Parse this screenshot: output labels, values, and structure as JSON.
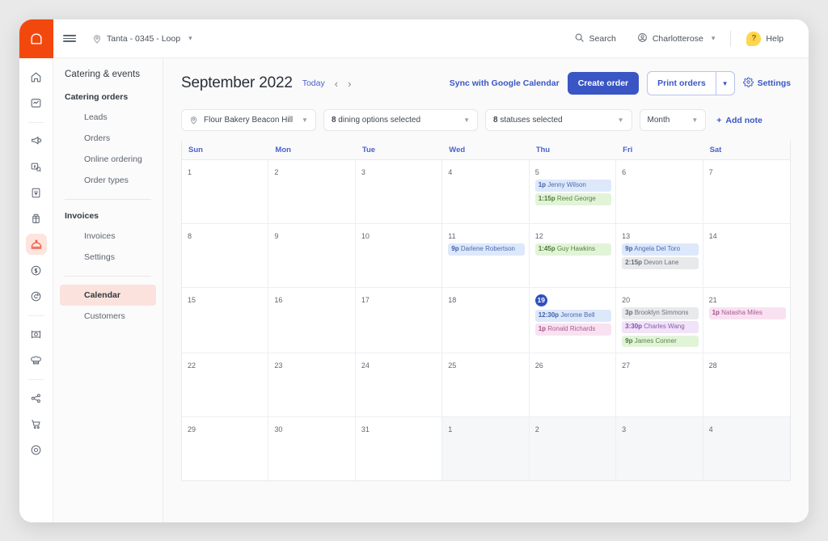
{
  "brand": {
    "logo_icon": "bread-loaf-icon",
    "accent_orange": "#f3480d",
    "accent_blue": "#3a56c4"
  },
  "topbar": {
    "menu_icon": "hamburger-icon",
    "location": {
      "icon": "map-pin-icon",
      "label": "Tanta - 0345 - Loop",
      "caret": "⌄"
    },
    "search": {
      "icon": "search-icon",
      "label": "Search"
    },
    "account": {
      "icon": "user-circle-icon",
      "label": "Charlotterose",
      "caret": "⌄"
    },
    "help": {
      "icon": "question-bubble-icon",
      "badge": "?",
      "label": "Help"
    }
  },
  "rail": {
    "items": [
      {
        "name": "home-icon",
        "active": false
      },
      {
        "name": "analytics-icon",
        "active": false
      },
      {
        "name": "separator",
        "active": false
      },
      {
        "name": "marketing-megaphone-icon",
        "active": false
      },
      {
        "name": "payments-icon",
        "active": false
      },
      {
        "name": "menu-book-icon",
        "active": false
      },
      {
        "name": "gift-card-icon",
        "active": false
      },
      {
        "name": "catering-dome-icon",
        "active": true
      },
      {
        "name": "dollar-circle-icon",
        "active": false
      },
      {
        "name": "loyalty-icon",
        "active": false
      },
      {
        "name": "separator",
        "active": false
      },
      {
        "name": "table-service-icon",
        "active": false
      },
      {
        "name": "chef-hat-icon",
        "active": false
      },
      {
        "name": "separator",
        "active": false
      },
      {
        "name": "share-nodes-icon",
        "active": false
      },
      {
        "name": "shopping-cart-icon",
        "active": false
      },
      {
        "name": "target-circle-icon",
        "active": false
      }
    ]
  },
  "sidebar": {
    "title": "Catering & events",
    "groups": [
      {
        "label": "Catering orders",
        "items": [
          {
            "label": "Leads",
            "active": false
          },
          {
            "label": "Orders",
            "active": false
          },
          {
            "label": "Online ordering",
            "active": false
          },
          {
            "label": "Order types",
            "active": false
          }
        ]
      },
      {
        "label": "Invoices",
        "items": [
          {
            "label": "Invoices",
            "active": false
          },
          {
            "label": "Settings",
            "active": false
          }
        ]
      },
      {
        "label": "",
        "items": [
          {
            "label": "Calendar",
            "active": true
          },
          {
            "label": "Customers",
            "active": false
          }
        ]
      }
    ]
  },
  "toolbar": {
    "month_title": "September 2022",
    "today_label": "Today",
    "prev_icon": "chevron-left-icon",
    "next_icon": "chevron-right-icon",
    "sync_label": "Sync with Google Calendar",
    "create_order_label": "Create order",
    "print_orders_label": "Print orders",
    "print_caret": "▼",
    "settings_label": "Settings",
    "settings_icon": "gear-icon"
  },
  "filters": {
    "location": {
      "icon": "map-pin-icon",
      "label": "Flour Bakery Beacon Hill"
    },
    "dining": {
      "count": "8",
      "label": " dining options selected"
    },
    "statuses": {
      "count": "8",
      "label": " statuses selected"
    },
    "view": {
      "label": "Month"
    },
    "add_note": {
      "icon": "plus-icon",
      "label": "Add note"
    }
  },
  "calendar": {
    "weekdays": [
      "Sun",
      "Mon",
      "Tue",
      "Wed",
      "Thu",
      "Fri",
      "Sat"
    ],
    "today": 19,
    "weeks": [
      [
        {
          "day": "1",
          "out": false,
          "events": []
        },
        {
          "day": "2",
          "out": false,
          "events": []
        },
        {
          "day": "3",
          "out": false,
          "events": []
        },
        {
          "day": "4",
          "out": false,
          "events": []
        },
        {
          "day": "5",
          "out": false,
          "events": [
            {
              "time": "1p",
              "name": "Jenny Wilson",
              "color": "blue"
            },
            {
              "time": "1:15p",
              "name": "Reed George",
              "color": "green"
            }
          ]
        },
        {
          "day": "6",
          "out": false,
          "events": []
        },
        {
          "day": "7",
          "out": false,
          "events": []
        }
      ],
      [
        {
          "day": "8",
          "out": false,
          "events": []
        },
        {
          "day": "9",
          "out": false,
          "events": []
        },
        {
          "day": "10",
          "out": false,
          "events": []
        },
        {
          "day": "11",
          "out": false,
          "events": [
            {
              "time": "9p",
              "name": "Darlene Robertson",
              "color": "blue"
            }
          ]
        },
        {
          "day": "12",
          "out": false,
          "events": [
            {
              "time": "1:45p",
              "name": "Guy Hawkins",
              "color": "green"
            }
          ]
        },
        {
          "day": "13",
          "out": false,
          "events": [
            {
              "time": "9p",
              "name": "Angela Del Toro",
              "color": "blue"
            },
            {
              "time": "2:15p",
              "name": "Devon Lane",
              "color": "grey"
            }
          ]
        },
        {
          "day": "14",
          "out": false,
          "events": []
        }
      ],
      [
        {
          "day": "15",
          "out": false,
          "events": []
        },
        {
          "day": "16",
          "out": false,
          "events": []
        },
        {
          "day": "17",
          "out": false,
          "events": []
        },
        {
          "day": "18",
          "out": false,
          "events": []
        },
        {
          "day": "19",
          "out": false,
          "today": true,
          "events": [
            {
              "time": "12:30p",
              "name": "Jerome Bell",
              "color": "blue"
            },
            {
              "time": "1p",
              "name": "Ronald Richards",
              "color": "pink"
            }
          ]
        },
        {
          "day": "20",
          "out": false,
          "events": [
            {
              "time": "3p",
              "name": "Brooklyn Simmons",
              "color": "grey"
            },
            {
              "time": "3:30p",
              "name": "Charles Wang",
              "color": "purple"
            },
            {
              "time": "9p",
              "name": "James Conner",
              "color": "green"
            }
          ]
        },
        {
          "day": "21",
          "out": false,
          "events": [
            {
              "time": "1p",
              "name": "Natasha Miles",
              "color": "pink"
            }
          ]
        }
      ],
      [
        {
          "day": "22",
          "out": false,
          "events": []
        },
        {
          "day": "23",
          "out": false,
          "events": []
        },
        {
          "day": "24",
          "out": false,
          "events": []
        },
        {
          "day": "25",
          "out": false,
          "events": []
        },
        {
          "day": "26",
          "out": false,
          "events": []
        },
        {
          "day": "27",
          "out": false,
          "events": []
        },
        {
          "day": "28",
          "out": false,
          "events": []
        }
      ],
      [
        {
          "day": "29",
          "out": false,
          "events": []
        },
        {
          "day": "30",
          "out": false,
          "events": []
        },
        {
          "day": "31",
          "out": false,
          "events": []
        },
        {
          "day": "1",
          "out": true,
          "events": []
        },
        {
          "day": "2",
          "out": true,
          "events": []
        },
        {
          "day": "3",
          "out": true,
          "events": []
        },
        {
          "day": "4",
          "out": true,
          "events": []
        }
      ]
    ]
  }
}
